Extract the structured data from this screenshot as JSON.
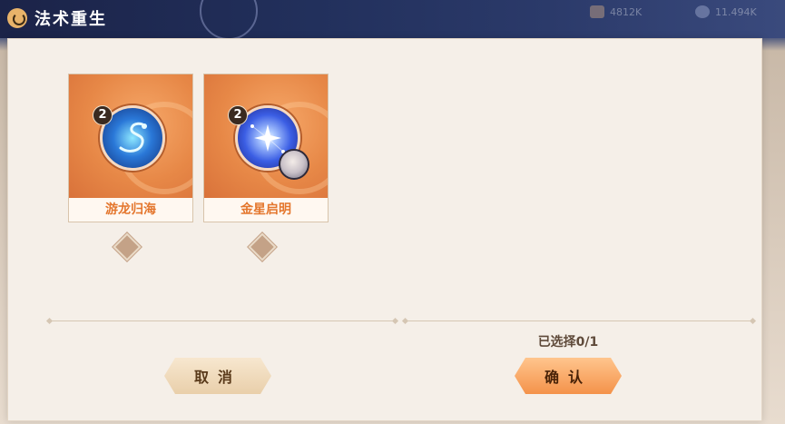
{
  "header": {
    "title": "法术重生",
    "resource_left": "4812K",
    "resource_right": "11.494K"
  },
  "spells": [
    {
      "name": "游龙归海",
      "level": "2",
      "icon": "dragon-spell-icon",
      "has_avatar": false
    },
    {
      "name": "金星启明",
      "level": "2",
      "icon": "star-spell-icon",
      "has_avatar": true
    }
  ],
  "selection": {
    "text": "已选择0/1"
  },
  "buttons": {
    "cancel": "取消",
    "confirm": "确认"
  },
  "colors": {
    "accent": "#e4762d",
    "card_art": "#e78847",
    "confirm_button": "#f4924a",
    "cancel_button": "#ecd6b6"
  }
}
